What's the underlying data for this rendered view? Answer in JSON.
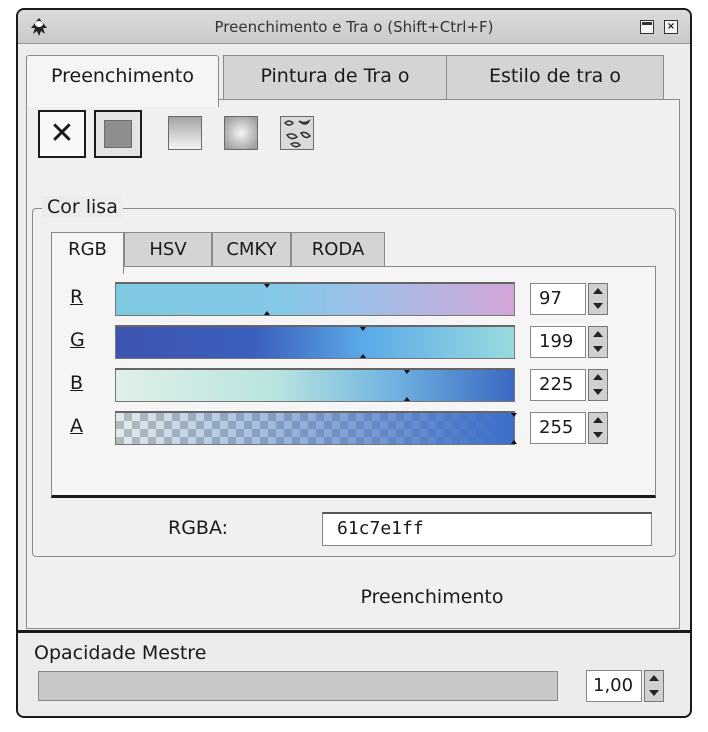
{
  "window": {
    "title": "Preenchimento e Tra o (Shift+Ctrl+F)",
    "close_label": "×"
  },
  "tabs": [
    {
      "label": "Preenchimento",
      "active": true
    },
    {
      "label": "Pintura de Tra o",
      "active": false
    },
    {
      "label": "Estilo de tra o",
      "active": false
    }
  ],
  "paint_modes": {
    "none_label": "✕",
    "selected": "flat-color"
  },
  "flat_color": {
    "legend": "Cor lisa",
    "subtabs": [
      {
        "label": "RGB",
        "active": true
      },
      {
        "label": "HSV",
        "active": false
      },
      {
        "label": "CMKY",
        "active": false
      },
      {
        "label": "RODA",
        "active": false
      }
    ],
    "channels": [
      {
        "label": "R",
        "value": "97",
        "fraction": 0.38
      },
      {
        "label": "G",
        "value": "199",
        "fraction": 0.62
      },
      {
        "label": "B",
        "value": "225",
        "fraction": 0.73
      },
      {
        "label": "A",
        "value": "255",
        "fraction": 1.0
      }
    ],
    "rgba_label": "RGBA:",
    "rgba_value": "61c7e1ff"
  },
  "mode_caption": "Preenchimento",
  "master_opacity": {
    "label": "Opacidade Mestre",
    "value": "1,00",
    "fraction": 1.0
  },
  "colors": {
    "fill": "#61c7e1"
  }
}
